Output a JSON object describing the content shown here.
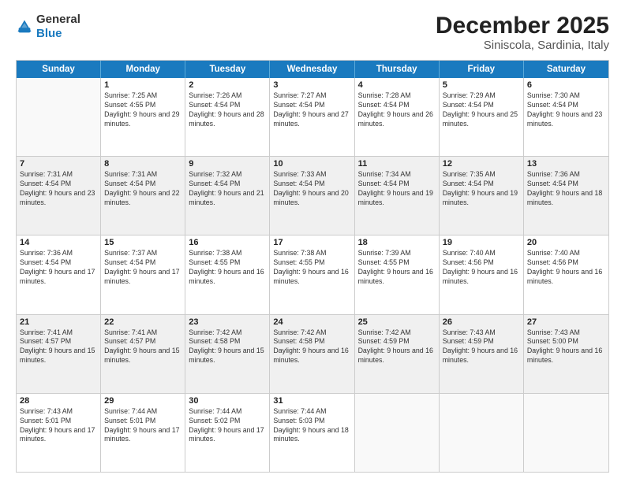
{
  "logo": {
    "text_general": "General",
    "text_blue": "Blue"
  },
  "title": "December 2025",
  "subtitle": "Siniscola, Sardinia, Italy",
  "weekdays": [
    "Sunday",
    "Monday",
    "Tuesday",
    "Wednesday",
    "Thursday",
    "Friday",
    "Saturday"
  ],
  "weeks": [
    [
      {
        "day": "",
        "sunrise": "",
        "sunset": "",
        "daylight": "",
        "empty": true
      },
      {
        "day": "1",
        "sunrise": "7:25 AM",
        "sunset": "4:55 PM",
        "daylight": "9 hours and 29 minutes."
      },
      {
        "day": "2",
        "sunrise": "7:26 AM",
        "sunset": "4:54 PM",
        "daylight": "9 hours and 28 minutes."
      },
      {
        "day": "3",
        "sunrise": "7:27 AM",
        "sunset": "4:54 PM",
        "daylight": "9 hours and 27 minutes."
      },
      {
        "day": "4",
        "sunrise": "7:28 AM",
        "sunset": "4:54 PM",
        "daylight": "9 hours and 26 minutes."
      },
      {
        "day": "5",
        "sunrise": "7:29 AM",
        "sunset": "4:54 PM",
        "daylight": "9 hours and 25 minutes."
      },
      {
        "day": "6",
        "sunrise": "7:30 AM",
        "sunset": "4:54 PM",
        "daylight": "9 hours and 23 minutes."
      }
    ],
    [
      {
        "day": "7",
        "sunrise": "7:31 AM",
        "sunset": "4:54 PM",
        "daylight": "9 hours and 23 minutes."
      },
      {
        "day": "8",
        "sunrise": "7:31 AM",
        "sunset": "4:54 PM",
        "daylight": "9 hours and 22 minutes."
      },
      {
        "day": "9",
        "sunrise": "7:32 AM",
        "sunset": "4:54 PM",
        "daylight": "9 hours and 21 minutes."
      },
      {
        "day": "10",
        "sunrise": "7:33 AM",
        "sunset": "4:54 PM",
        "daylight": "9 hours and 20 minutes."
      },
      {
        "day": "11",
        "sunrise": "7:34 AM",
        "sunset": "4:54 PM",
        "daylight": "9 hours and 19 minutes."
      },
      {
        "day": "12",
        "sunrise": "7:35 AM",
        "sunset": "4:54 PM",
        "daylight": "9 hours and 19 minutes."
      },
      {
        "day": "13",
        "sunrise": "7:36 AM",
        "sunset": "4:54 PM",
        "daylight": "9 hours and 18 minutes."
      }
    ],
    [
      {
        "day": "14",
        "sunrise": "7:36 AM",
        "sunset": "4:54 PM",
        "daylight": "9 hours and 17 minutes."
      },
      {
        "day": "15",
        "sunrise": "7:37 AM",
        "sunset": "4:54 PM",
        "daylight": "9 hours and 17 minutes."
      },
      {
        "day": "16",
        "sunrise": "7:38 AM",
        "sunset": "4:55 PM",
        "daylight": "9 hours and 16 minutes."
      },
      {
        "day": "17",
        "sunrise": "7:38 AM",
        "sunset": "4:55 PM",
        "daylight": "9 hours and 16 minutes."
      },
      {
        "day": "18",
        "sunrise": "7:39 AM",
        "sunset": "4:55 PM",
        "daylight": "9 hours and 16 minutes."
      },
      {
        "day": "19",
        "sunrise": "7:40 AM",
        "sunset": "4:56 PM",
        "daylight": "9 hours and 16 minutes."
      },
      {
        "day": "20",
        "sunrise": "7:40 AM",
        "sunset": "4:56 PM",
        "daylight": "9 hours and 16 minutes."
      }
    ],
    [
      {
        "day": "21",
        "sunrise": "7:41 AM",
        "sunset": "4:57 PM",
        "daylight": "9 hours and 15 minutes."
      },
      {
        "day": "22",
        "sunrise": "7:41 AM",
        "sunset": "4:57 PM",
        "daylight": "9 hours and 15 minutes."
      },
      {
        "day": "23",
        "sunrise": "7:42 AM",
        "sunset": "4:58 PM",
        "daylight": "9 hours and 15 minutes."
      },
      {
        "day": "24",
        "sunrise": "7:42 AM",
        "sunset": "4:58 PM",
        "daylight": "9 hours and 16 minutes."
      },
      {
        "day": "25",
        "sunrise": "7:42 AM",
        "sunset": "4:59 PM",
        "daylight": "9 hours and 16 minutes."
      },
      {
        "day": "26",
        "sunrise": "7:43 AM",
        "sunset": "4:59 PM",
        "daylight": "9 hours and 16 minutes."
      },
      {
        "day": "27",
        "sunrise": "7:43 AM",
        "sunset": "5:00 PM",
        "daylight": "9 hours and 16 minutes."
      }
    ],
    [
      {
        "day": "28",
        "sunrise": "7:43 AM",
        "sunset": "5:01 PM",
        "daylight": "9 hours and 17 minutes."
      },
      {
        "day": "29",
        "sunrise": "7:44 AM",
        "sunset": "5:01 PM",
        "daylight": "9 hours and 17 minutes."
      },
      {
        "day": "30",
        "sunrise": "7:44 AM",
        "sunset": "5:02 PM",
        "daylight": "9 hours and 17 minutes."
      },
      {
        "day": "31",
        "sunrise": "7:44 AM",
        "sunset": "5:03 PM",
        "daylight": "9 hours and 18 minutes."
      },
      {
        "day": "",
        "sunrise": "",
        "sunset": "",
        "daylight": "",
        "empty": true
      },
      {
        "day": "",
        "sunrise": "",
        "sunset": "",
        "daylight": "",
        "empty": true
      },
      {
        "day": "",
        "sunrise": "",
        "sunset": "",
        "daylight": "",
        "empty": true
      }
    ]
  ],
  "labels": {
    "sunrise": "Sunrise:",
    "sunset": "Sunset:",
    "daylight": "Daylight:"
  }
}
